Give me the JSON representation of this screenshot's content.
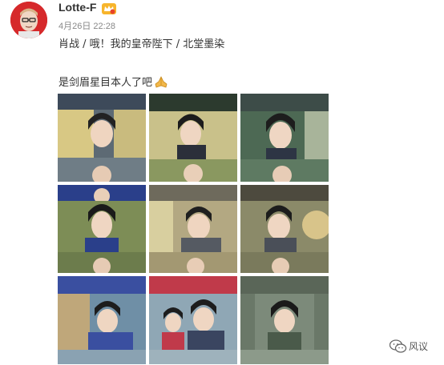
{
  "post": {
    "username": "Lotte-F",
    "timestamp": "4月26日 22:28",
    "text_line1": "肖战 / 哦！我的皇帝陛下 / 北堂墨染",
    "text_line2": "是剑眉星目本人了吧",
    "emoji_icon": "praying-hands-icon",
    "vip_icon": "vip-crown-icon"
  },
  "grid": {
    "images": [
      {
        "name": "photo-1",
        "bg": "#5f6a73",
        "accent": "#d9c27a"
      },
      {
        "name": "photo-2",
        "bg": "#6d7a56",
        "accent": "#c9c08a"
      },
      {
        "name": "photo-3",
        "bg": "#4f6a55",
        "accent": "#8aa08a"
      },
      {
        "name": "photo-4",
        "bg": "#6e7a4e",
        "accent": "#2a3f8a"
      },
      {
        "name": "photo-5",
        "bg": "#b4a883",
        "accent": "#555a62"
      },
      {
        "name": "photo-6",
        "bg": "#8b8b6a",
        "accent": "#d8c48a"
      },
      {
        "name": "photo-7",
        "bg": "#6f8fa6",
        "accent": "#3a4fa0"
      },
      {
        "name": "photo-8",
        "bg": "#8fa7b5",
        "accent": "#c03a4a"
      },
      {
        "name": "photo-9",
        "bg": "#7c8a7a",
        "accent": "#4a5a4a"
      }
    ]
  },
  "watermark": {
    "text": "风议",
    "icon": "wechat-icon"
  }
}
